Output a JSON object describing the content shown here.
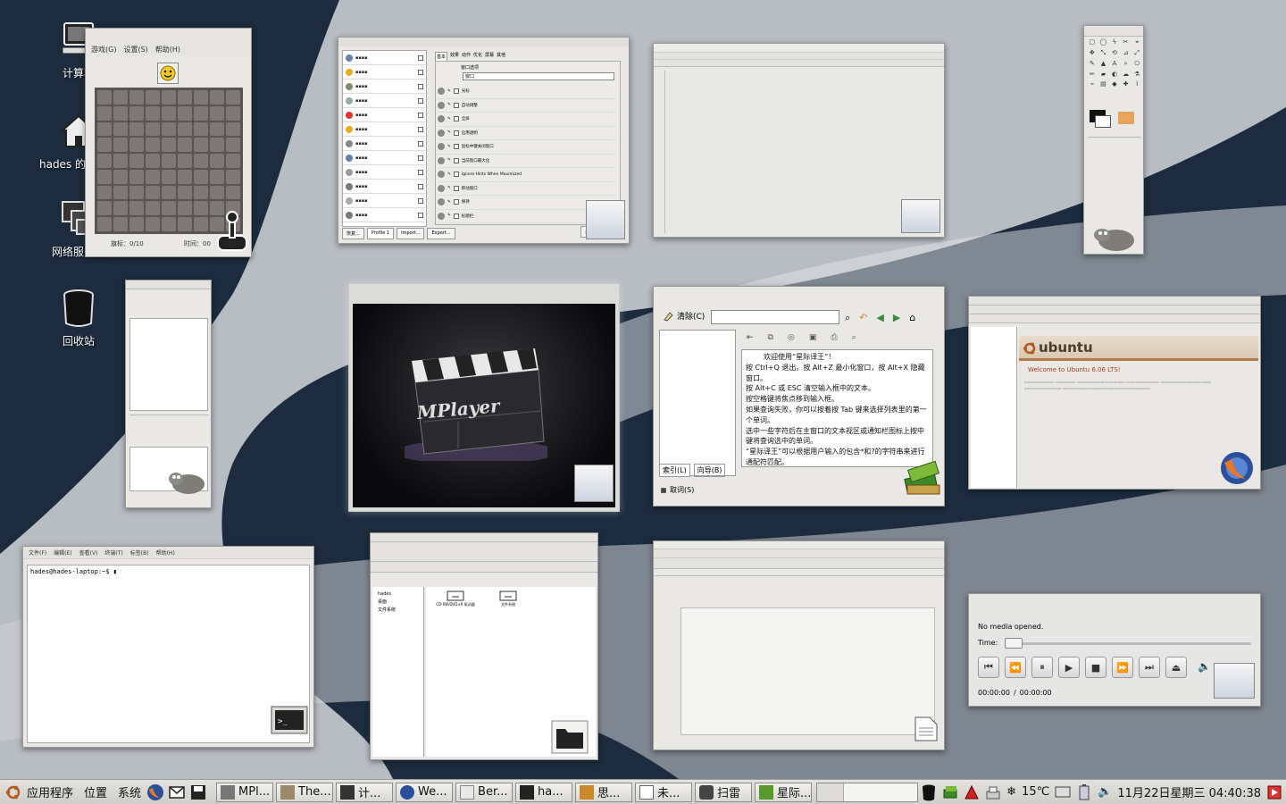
{
  "desktop_icons": [
    {
      "label": "计算机",
      "icon": "computer-icon"
    },
    {
      "label": "hades 的主目录",
      "icon": "home-folder-icon"
    },
    {
      "label": "网络服务器",
      "icon": "network-servers-icon"
    },
    {
      "label": "回收站",
      "icon": "trash-icon"
    }
  ],
  "mines_window": {
    "menu": [
      "游戏(G)",
      "设置(S)",
      "帮助(H)"
    ],
    "flags_label": "旗标：0/10",
    "time_label": "时间：00"
  },
  "settings_window": {
    "tabs": [
      "基本",
      "效果",
      "动作",
      "优化",
      "屏幕",
      "其他"
    ],
    "section_label": "窗口选项",
    "select_value": "窗口",
    "options": [
      "光标",
      "自动调整",
      "全屏",
      "启用透明",
      "鼠标中键关闭窗口",
      "当前窗口最大化",
      "Ignore Hints When Maximized",
      "移动窗口",
      "保持",
      "标题栏"
    ],
    "buttons": [
      "恢复...",
      "Profile 1",
      "Import...",
      "Export...",
      "关闭"
    ]
  },
  "dictionary": {
    "clear_label": "清除(C)",
    "index_tab": "索引(L)",
    "wizard_tab": "向导(B)",
    "cancel_label": "取词(S)",
    "welcome": "欢迎使用“星际译王”！",
    "lines": [
      "按 Ctrl+Q 退出。按 Alt+Z 最小化窗口，按 Alt+X 隐藏窗口。",
      "按 Alt+C 或 ESC 清空输入框中的文本。",
      "按空格键将焦点移到输入框。",
      "如果查询失败，你可以按着按 Tab 键来选择列表里的第一个单词。",
      "选中一些字符后在主窗口的文本视区或通知栏图标上按中键将查询选中的单词。",
      "“星际译王”可以根据用户输入的包含*和?的字符串来进行通配符匹配。"
    ]
  },
  "browser": {
    "brand": "ubuntu",
    "heading": "Welcome to Ubuntu 6.06 LTS!"
  },
  "terminal": {
    "menu": [
      "文件(F)",
      "编辑(E)",
      "查看(V)",
      "终端(T)",
      "标签(B)",
      "帮助(H)"
    ],
    "prompt": "hades@hades-laptop:~$"
  },
  "file_manager": {
    "items": [
      "CD-RW/DVD±R 驱动器",
      "文件系统"
    ],
    "side_items": [
      "hades",
      "桌面",
      "文件系统"
    ]
  },
  "media_player": {
    "status": "No media opened.",
    "time_label": "Time:",
    "position": "00:00:00",
    "separator": "/",
    "duration": "00:00:00"
  },
  "mplayer_logo": "MPlayer",
  "panel": {
    "menus": [
      "应用程序",
      "位置",
      "系统"
    ],
    "tasks": [
      {
        "label": "MPl...",
        "icon": "mplayer-task-icon"
      },
      {
        "label": "The...",
        "icon": "gimp-task-icon"
      },
      {
        "label": "计...",
        "icon": "folder-task-icon"
      },
      {
        "label": "We...",
        "icon": "firefox-task-icon"
      },
      {
        "label": "Ber...",
        "icon": "ber-task-icon"
      },
      {
        "label": "ha...",
        "icon": "terminal-task-icon"
      },
      {
        "label": "思...",
        "icon": "mind-task-icon"
      },
      {
        "label": "未...",
        "icon": "document-task-icon"
      },
      {
        "label": "扫雷",
        "icon": "mines-task-icon"
      },
      {
        "label": "星际...",
        "icon": "stardict-task-icon"
      }
    ],
    "temperature": "15℃",
    "clock": "11月22日星期三 04:40:38"
  },
  "colors": {
    "wallpaper_dark": "#1b2b3d",
    "wallpaper_light": "#c9ccd1",
    "panel": "#dcdbd7",
    "ubuntu_orange": "#b35b22"
  }
}
